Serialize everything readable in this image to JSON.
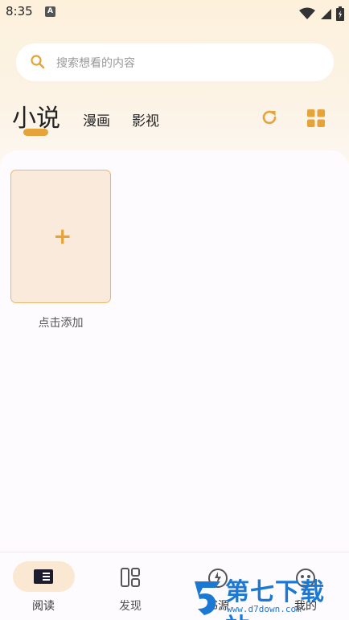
{
  "status_bar": {
    "time": "8:35",
    "notification_icon": "a-icon",
    "icons": [
      "wifi-icon",
      "signal-icon",
      "battery-icon"
    ]
  },
  "search": {
    "placeholder": "搜索想看的内容",
    "icon": "search-icon"
  },
  "tabs": [
    {
      "label": "小说",
      "active": true
    },
    {
      "label": "漫画",
      "active": false
    },
    {
      "label": "影视",
      "active": false
    }
  ],
  "toolbar_icons": [
    "refresh-icon",
    "grid-icon"
  ],
  "bookshelf": {
    "add_tile_icon": "plus-icon",
    "add_label": "点击添加"
  },
  "bottom_nav": [
    {
      "label": "阅读",
      "icon": "book-icon",
      "active": true
    },
    {
      "label": "发现",
      "icon": "layout-icon",
      "active": false
    },
    {
      "label": "书源",
      "icon": "source-icon",
      "active": false
    },
    {
      "label": "我的",
      "icon": "face-icon",
      "active": false
    }
  ],
  "watermark": {
    "title": "第七下载站",
    "url": "www.d7down.com"
  },
  "colors": {
    "accent": "#e5a33a",
    "tile_bg": "#faeadc",
    "nav_active_bg": "#fbe8d2",
    "watermark": "#1b78d3"
  }
}
